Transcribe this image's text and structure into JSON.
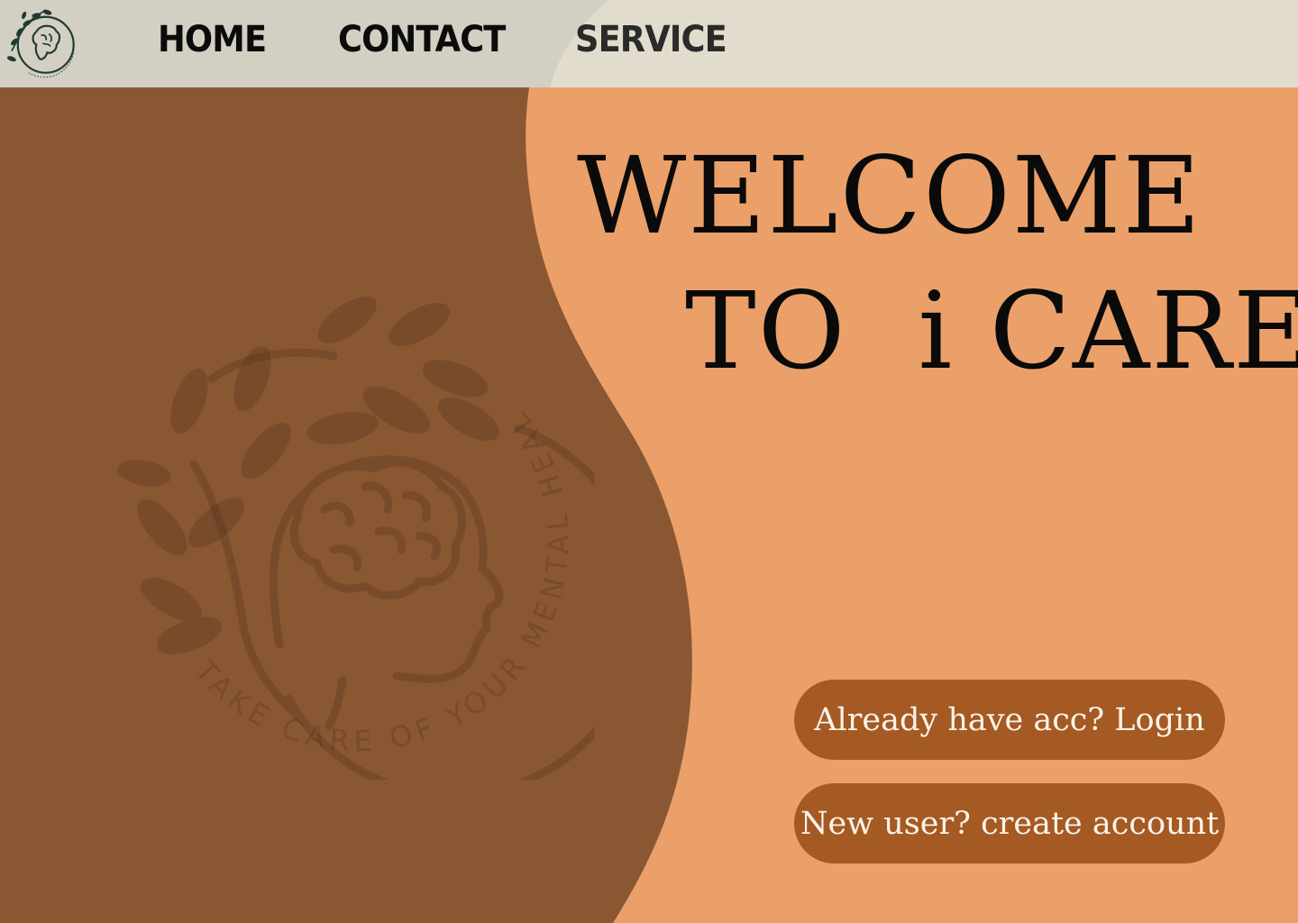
{
  "nav": {
    "logo_alt": "TAKE CARE OF YOUR MENTAL HEALTH",
    "items": [
      {
        "label": "HOME"
      },
      {
        "label": "CONTACT"
      },
      {
        "label": "SERVICE"
      }
    ]
  },
  "hero": {
    "line1": "WELCOME",
    "line2": "TO  i CARE"
  },
  "watermark": {
    "text": "TAKE CARE OF YOUR MENTAL HEALTH",
    "icon": "brain-head-leaves-icon"
  },
  "actions": {
    "login_label": "Already have acc? Login",
    "signup_label": "New user? create account"
  },
  "colors": {
    "page_bg": "#eba06a",
    "brown_panel": "#8a5733",
    "nav_bg": "#e2dccc",
    "button_bg": "#a55a24",
    "button_text": "#fbf4ea"
  }
}
